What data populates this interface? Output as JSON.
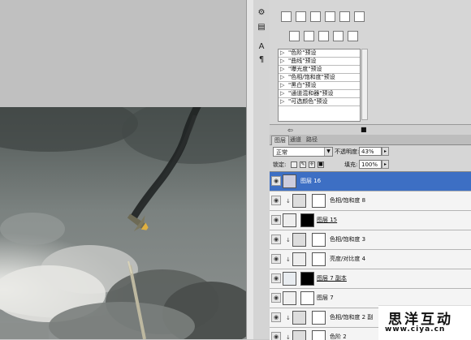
{
  "adjustments": {
    "presets": [
      "\"色阶\"预设",
      "\"曲线\"预设",
      "\"曝光度\"预设",
      "\"色相/饱和度\"预设",
      "\"黑白\"预设",
      "\"通道混和器\"预设",
      "\"可选颜色\"预设"
    ]
  },
  "layers_panel": {
    "tabs": [
      "图层",
      "通道",
      "路径"
    ],
    "blend_mode": "正常",
    "opacity_label": "不透明度:",
    "opacity_value": "43%",
    "lock_label": "锁定:",
    "fill_label": "填充:",
    "fill_value": "100%",
    "layers": [
      {
        "name": "图层 16",
        "selected": true
      },
      {
        "name": "色相/饱和度 8"
      },
      {
        "name": "图层 15"
      },
      {
        "name": "色相/饱和度 3"
      },
      {
        "name": "亮度/对比度 4"
      },
      {
        "name": "图层 7 副本"
      },
      {
        "name": "图层 7"
      },
      {
        "name": "色相/饱和度 2 副"
      },
      {
        "name": "色阶 2"
      }
    ]
  },
  "watermark": {
    "title": "思洋互动",
    "url": "www.ciya.cn"
  }
}
